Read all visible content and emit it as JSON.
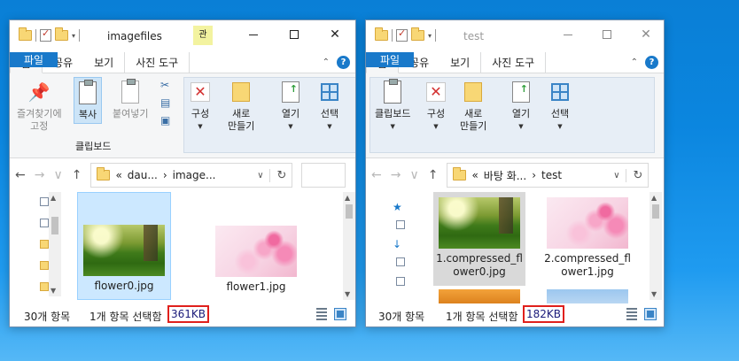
{
  "window1": {
    "title": "imagefiles",
    "manage_tag": "관",
    "tabs": {
      "file": "파일",
      "home": "홈",
      "share": "공유",
      "view": "보기",
      "context": "사진 도구"
    },
    "help": "?",
    "ribbon": {
      "pin": "즐겨찾기에\n고정",
      "copy": "복사",
      "paste": "붙여넣기",
      "group_clipboard": "클립보드",
      "organize": "구성",
      "new": "새로\n만들기",
      "open": "열기",
      "select": "선택"
    },
    "address": {
      "prefix": "«",
      "part1": "dau...",
      "sep": "›",
      "part2": "image..."
    },
    "files": [
      {
        "name": "flower0.jpg",
        "thumb": "grass"
      },
      {
        "name": "flower1.jpg",
        "thumb": "flower"
      }
    ],
    "status": {
      "count": "30개 항목",
      "selected": "1개 항목 선택함",
      "size": "361KB"
    }
  },
  "window2": {
    "title": "test",
    "tabs": {
      "file": "파일",
      "home": "홈",
      "share": "공유",
      "view": "보기",
      "context": "사진 도구"
    },
    "help": "?",
    "ribbon": {
      "clipboard": "클립보드",
      "organize": "구성",
      "new": "새로\n만들기",
      "open": "열기",
      "select": "선택"
    },
    "address": {
      "prefix": "«",
      "part1": "바탕 화...",
      "sep": "›",
      "part2": "test"
    },
    "files": [
      {
        "name": "1.compressed_fl\nower0.jpg",
        "thumb": "grass"
      },
      {
        "name": "2.compressed_fl\nower1.jpg",
        "thumb": "flower"
      }
    ],
    "status": {
      "count": "30개 항목",
      "selected": "1개 항목 선택함",
      "size": "182KB"
    }
  },
  "colors": {
    "accent": "#1979ca",
    "highlight": "#e0201c",
    "selection": "#cce8ff"
  }
}
